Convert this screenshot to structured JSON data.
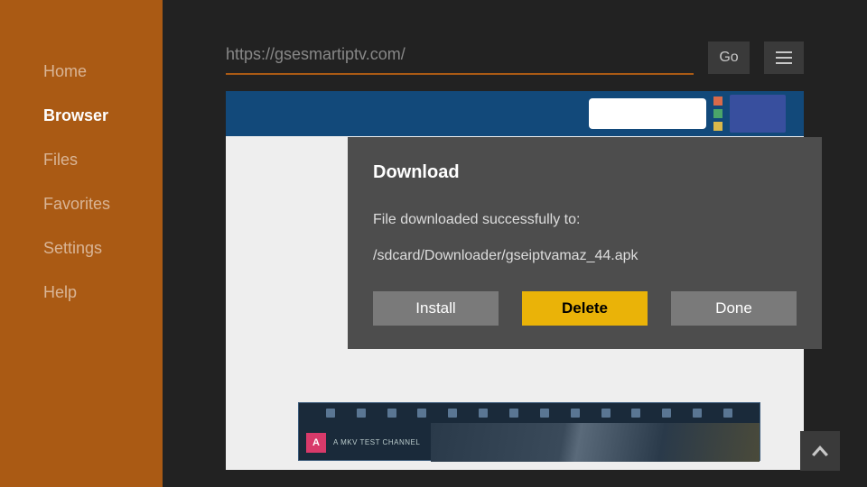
{
  "sidebar": {
    "items": [
      {
        "label": "Home"
      },
      {
        "label": "Browser"
      },
      {
        "label": "Files"
      },
      {
        "label": "Favorites"
      },
      {
        "label": "Settings"
      },
      {
        "label": "Help"
      }
    ],
    "active_index": 1
  },
  "urlbar": {
    "url": "https://gsesmartiptv.com/",
    "go_label": "Go"
  },
  "page": {
    "player_channel_badge": "A",
    "player_channel_name": "A MKV TEST CHANNEL"
  },
  "modal": {
    "title": "Download",
    "message": "File downloaded successfully to:",
    "path": "/sdcard/Downloader/gseiptvamaz_44.apk",
    "install_label": "Install",
    "delete_label": "Delete",
    "done_label": "Done"
  }
}
